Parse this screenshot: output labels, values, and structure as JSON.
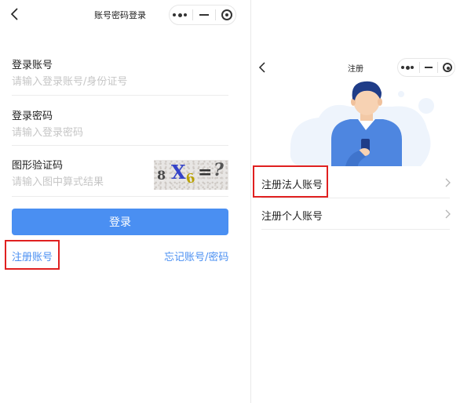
{
  "left": {
    "nav": {
      "title": "账号密码登录"
    },
    "account": {
      "label": "登录账号",
      "placeholder": "请输入登录账号/身份证号",
      "value": ""
    },
    "password": {
      "label": "登录密码",
      "placeholder": "请输入登录密码",
      "value": ""
    },
    "captcha": {
      "label": "图形验证码",
      "placeholder": "请输入图中算式结果",
      "value": "",
      "image_chars": [
        "8",
        "X",
        "6",
        "=",
        "?"
      ]
    },
    "login_label": "登录",
    "register_link": "注册账号",
    "forgot_link": "忘记账号/密码"
  },
  "right": {
    "nav": {
      "title": "注册"
    },
    "options": [
      {
        "label": "注册法人账号"
      },
      {
        "label": "注册个人账号"
      }
    ]
  },
  "colors": {
    "accent": "#4a8ff2",
    "highlight": "#e02020",
    "illustration_shirt": "#4e86e0",
    "illustration_hair": "#1f3c88"
  },
  "icons": [
    "chevron-left-icon",
    "more-dots-icon",
    "minimize-icon",
    "target-icon",
    "chevron-right-icon"
  ]
}
